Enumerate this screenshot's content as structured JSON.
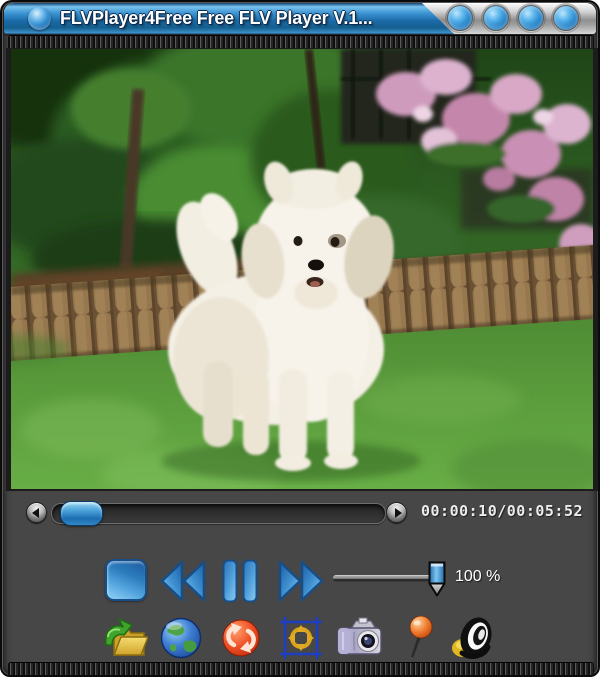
{
  "window": {
    "title": "FLVPlayer4Free Free FLV Player V.1...",
    "app_icon": "blue-orb-icon",
    "titlebar_button_icons": [
      "round-blue-button",
      "round-blue-button",
      "round-blue-button",
      "round-blue-button"
    ]
  },
  "video": {
    "description": "White fluffy dog standing on a lawn in front of a wooden log edging, green bushes and pink blossoms"
  },
  "transport": {
    "time_display": "00:00:10/00:05:52",
    "seek_back_icon": "seek-back-arrow-icon",
    "seek_forward_icon": "seek-forward-arrow-icon",
    "seek_position_fraction": 0.03,
    "buttons": [
      {
        "id": "stop",
        "icon": "stop-icon"
      },
      {
        "id": "rewind",
        "icon": "rewind-icon"
      },
      {
        "id": "pause",
        "icon": "pause-icon"
      },
      {
        "id": "fast-forward",
        "icon": "fast-forward-icon"
      }
    ]
  },
  "volume": {
    "label": "100 %",
    "percent": 100,
    "thumb_icon": "volume-slider-thumb"
  },
  "toolbar": {
    "icons": [
      {
        "id": "open-file",
        "icon": "open-folder-icon"
      },
      {
        "id": "open-url",
        "icon": "globe-icon"
      },
      {
        "id": "repeat",
        "icon": "orange-refresh-icon"
      },
      {
        "id": "fullscreen",
        "icon": "fullscreen-arrows-icon"
      },
      {
        "id": "snapshot",
        "icon": "camera-icon"
      },
      {
        "id": "always-on-top",
        "icon": "pin-icon"
      },
      {
        "id": "mute",
        "icon": "speaker-icon"
      }
    ]
  },
  "colors": {
    "titlebar_blue": "#2a82c4",
    "accent_blue": "#2f8fd4",
    "panel_gray": "#474747",
    "time_text": "#ececec"
  }
}
